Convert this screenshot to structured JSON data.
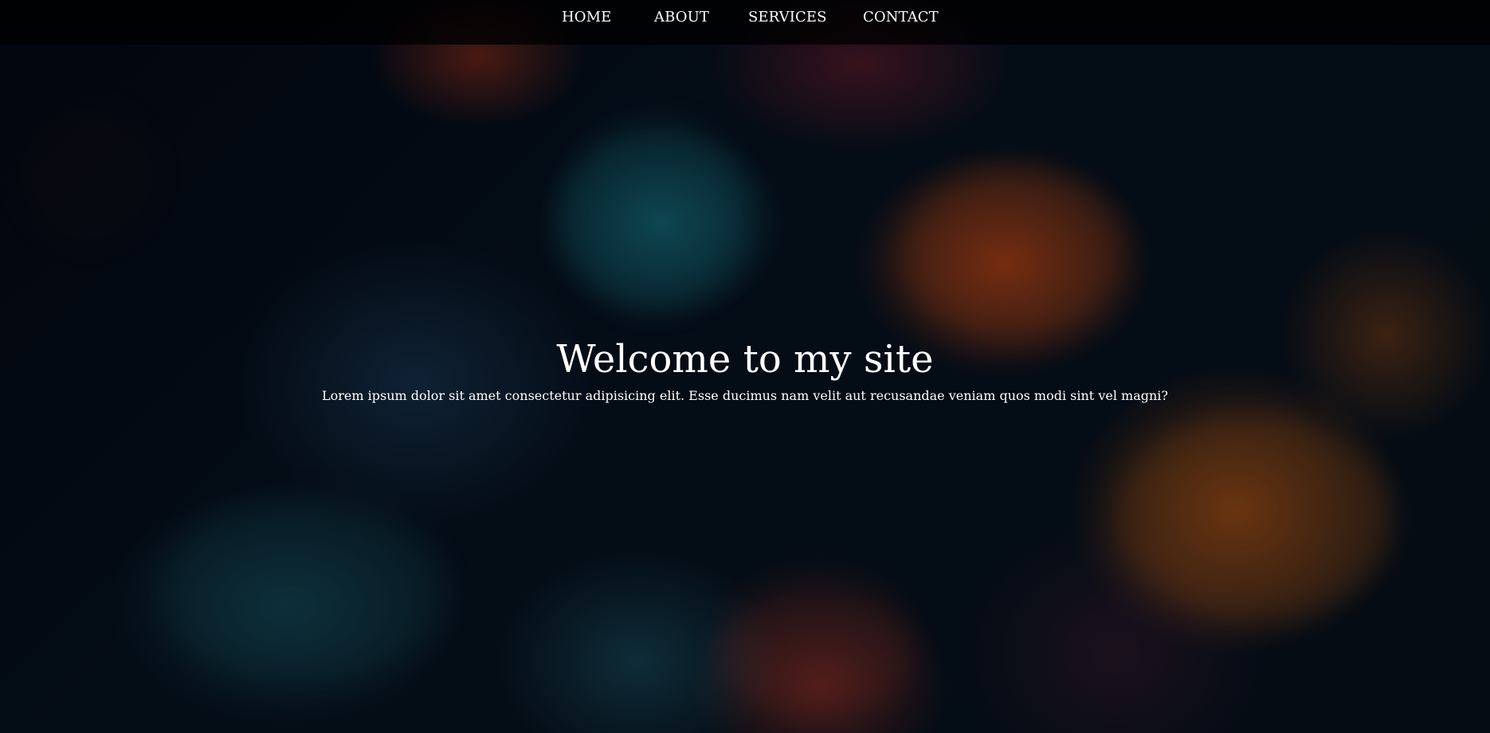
{
  "nav": {
    "items": [
      {
        "label": "HOME"
      },
      {
        "label": "ABOUT"
      },
      {
        "label": "SERVICES"
      },
      {
        "label": "CONTACT"
      }
    ]
  },
  "hero": {
    "title": "Welcome to my site",
    "subtitle": "Lorem ipsum dolor sit amet consectetur adipisicing elit. Esse ducimus nam velit aut recusandae veniam quos modi sint vel magni?"
  },
  "colors": {
    "text": "#ffffff",
    "nav_background": "#000000"
  }
}
